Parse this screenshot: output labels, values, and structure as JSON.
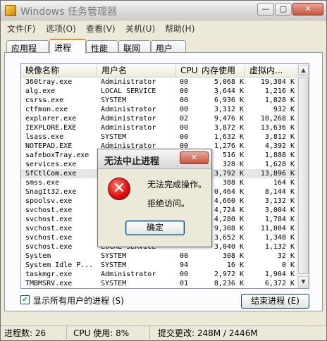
{
  "window": {
    "title": "Windows 任务管理器",
    "min_glyph": "—",
    "max_glyph": "□",
    "close_glyph": "✕"
  },
  "menu": [
    "文件(F)",
    "选项(O)",
    "查看(V)",
    "关机(U)",
    "帮助(H)"
  ],
  "tabs": [
    "应用程序",
    "进程",
    "性能",
    "联网",
    "用户"
  ],
  "active_tab": "进程",
  "columns": [
    "映像名称",
    "用户名",
    "CPU",
    "内存使用",
    "虚拟内..."
  ],
  "processes": [
    {
      "name": "360tray.exe",
      "user": "Administrator",
      "cpu": "00",
      "mem": "5,068 K",
      "vm": "19,384 K"
    },
    {
      "name": "alg.exe",
      "user": "LOCAL SERVICE",
      "cpu": "00",
      "mem": "3,644 K",
      "vm": "1,216 K"
    },
    {
      "name": "csrss.exe",
      "user": "SYSTEM",
      "cpu": "00",
      "mem": "6,936 K",
      "vm": "1,828 K"
    },
    {
      "name": "ctfmon.exe",
      "user": "Administrator",
      "cpu": "00",
      "mem": "3,312 K",
      "vm": "932 K"
    },
    {
      "name": "explorer.exe",
      "user": "Administrator",
      "cpu": "02",
      "mem": "9,476 K",
      "vm": "10,268 K"
    },
    {
      "name": "IEXPLORE.EXE",
      "user": "Administrator",
      "cpu": "00",
      "mem": "3,872 K",
      "vm": "13,636 K"
    },
    {
      "name": "lsass.exe",
      "user": "SYSTEM",
      "cpu": "00",
      "mem": "1,632 K",
      "vm": "3,812 K"
    },
    {
      "name": "NOTEPAD.EXE",
      "user": "Administrator",
      "cpu": "00",
      "mem": "1,276 K",
      "vm": "4,392 K"
    },
    {
      "name": "safeboxTray.exe",
      "user": "",
      "cpu": "",
      "mem": "516 K",
      "vm": "1,888 K"
    },
    {
      "name": "services.exe",
      "user": "",
      "cpu": "",
      "mem": "328 K",
      "vm": "1,628 K"
    },
    {
      "name": "SfCtlCom.exe",
      "user": "",
      "cpu": "",
      "mem": "3,792 K",
      "vm": "13,896 K"
    },
    {
      "name": "smss.exe",
      "user": "",
      "cpu": "",
      "mem": "388 K",
      "vm": "164 K"
    },
    {
      "name": "SnagIt32.exe",
      "user": "",
      "cpu": "",
      "mem": "0,464 K",
      "vm": "8,144 K"
    },
    {
      "name": "spoolsv.exe",
      "user": "",
      "cpu": "",
      "mem": "4,660 K",
      "vm": "3,132 K"
    },
    {
      "name": "svchost.exe",
      "user": "",
      "cpu": "",
      "mem": "4,724 K",
      "vm": "3,004 K"
    },
    {
      "name": "svchost.exe",
      "user": "",
      "cpu": "",
      "mem": "4,280 K",
      "vm": "1,784 K"
    },
    {
      "name": "svchost.exe",
      "user": "",
      "cpu": "",
      "mem": "9,308 K",
      "vm": "11,004 K"
    },
    {
      "name": "svchost.exe",
      "user": "",
      "cpu": "",
      "mem": "3,652 K",
      "vm": "1,348 K"
    },
    {
      "name": "svchost.exe",
      "user": "LOCAL SERVICE",
      "cpu": "",
      "mem": "3,040 K",
      "vm": "1,132 K"
    },
    {
      "name": "System",
      "user": "SYSTEM",
      "cpu": "00",
      "mem": "308 K",
      "vm": "32 K"
    },
    {
      "name": "System Idle P...",
      "user": "SYSTEM",
      "cpu": "94",
      "mem": "16 K",
      "vm": "0 K"
    },
    {
      "name": "taskmgr.exe",
      "user": "Administrator",
      "cpu": "00",
      "mem": "2,972 K",
      "vm": "1,904 K"
    },
    {
      "name": "TMBMSRV.exe",
      "user": "SYSTEM",
      "cpu": "01",
      "mem": "8,236 K",
      "vm": "6,372 K"
    }
  ],
  "selected_row": 10,
  "show_all_label": "显示所有用户的进程 (S)",
  "show_all_checked": "✔",
  "end_process_label": "结束进程 (E)",
  "status": {
    "processes": "进程数: 26",
    "cpu": "CPU 使用: 8%",
    "commit": "提交更改: 248M / 2446M"
  },
  "dialog": {
    "title": "无法中止进程",
    "close_glyph": "✕",
    "icon_glyph": "✕",
    "line1": "无法完成操作。",
    "line2": "拒绝访问。",
    "ok_label": "确定"
  }
}
